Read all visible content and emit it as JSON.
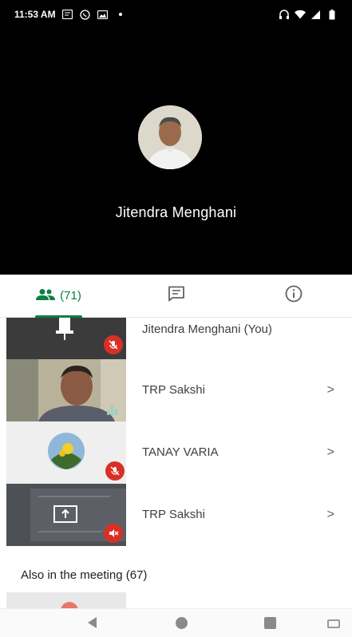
{
  "status_bar": {
    "time": "11:53 AM"
  },
  "stage": {
    "speaker_name": "Jitendra Menghani"
  },
  "tabs": {
    "people_count": "(71)",
    "people_icon": "people-icon",
    "chat_icon": "chat-icon",
    "info_icon": "info-icon",
    "accent": "#0b8043"
  },
  "participants": [
    {
      "name": "Jitendra Menghani (You)",
      "mic": "muted"
    },
    {
      "name": "TRP Sakshi",
      "mic": "talking",
      "chevron": ">"
    },
    {
      "name": "TANAY VARIA",
      "mic": "muted",
      "chevron": ">"
    },
    {
      "name": "TRP Sakshi",
      "mic": "muted",
      "chevron": ">"
    }
  ],
  "also_in_meeting": {
    "title": "Also in the meeting (67)"
  },
  "colors": {
    "mute_badge": "#d93025",
    "stage_bg": "#000000"
  }
}
